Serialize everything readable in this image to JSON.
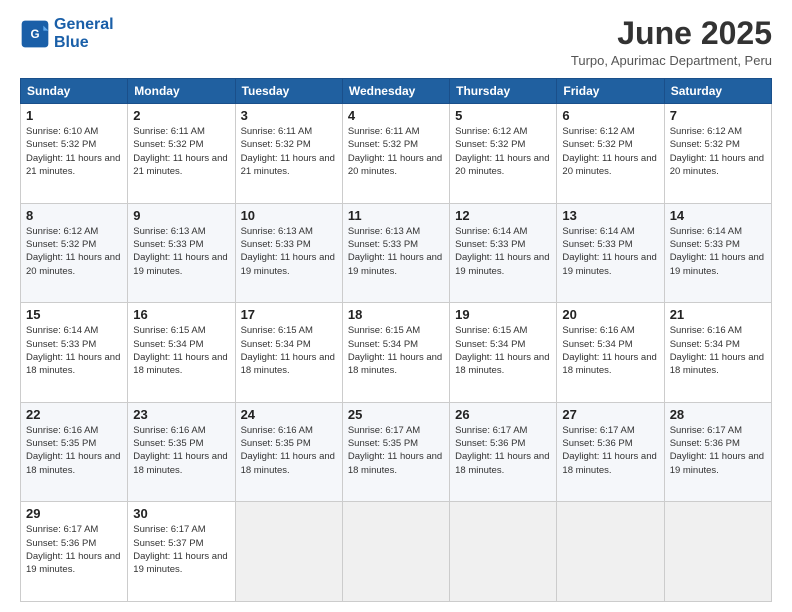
{
  "logo": {
    "line1": "General",
    "line2": "Blue"
  },
  "title": "June 2025",
  "location": "Turpo, Apurimac Department, Peru",
  "weekdays": [
    "Sunday",
    "Monday",
    "Tuesday",
    "Wednesday",
    "Thursday",
    "Friday",
    "Saturday"
  ],
  "weeks": [
    [
      {
        "day": "1",
        "sunrise": "Sunrise: 6:10 AM",
        "sunset": "Sunset: 5:32 PM",
        "daylight": "Daylight: 11 hours and 21 minutes."
      },
      {
        "day": "2",
        "sunrise": "Sunrise: 6:11 AM",
        "sunset": "Sunset: 5:32 PM",
        "daylight": "Daylight: 11 hours and 21 minutes."
      },
      {
        "day": "3",
        "sunrise": "Sunrise: 6:11 AM",
        "sunset": "Sunset: 5:32 PM",
        "daylight": "Daylight: 11 hours and 21 minutes."
      },
      {
        "day": "4",
        "sunrise": "Sunrise: 6:11 AM",
        "sunset": "Sunset: 5:32 PM",
        "daylight": "Daylight: 11 hours and 20 minutes."
      },
      {
        "day": "5",
        "sunrise": "Sunrise: 6:12 AM",
        "sunset": "Sunset: 5:32 PM",
        "daylight": "Daylight: 11 hours and 20 minutes."
      },
      {
        "day": "6",
        "sunrise": "Sunrise: 6:12 AM",
        "sunset": "Sunset: 5:32 PM",
        "daylight": "Daylight: 11 hours and 20 minutes."
      },
      {
        "day": "7",
        "sunrise": "Sunrise: 6:12 AM",
        "sunset": "Sunset: 5:32 PM",
        "daylight": "Daylight: 11 hours and 20 minutes."
      }
    ],
    [
      {
        "day": "8",
        "sunrise": "Sunrise: 6:12 AM",
        "sunset": "Sunset: 5:32 PM",
        "daylight": "Daylight: 11 hours and 20 minutes."
      },
      {
        "day": "9",
        "sunrise": "Sunrise: 6:13 AM",
        "sunset": "Sunset: 5:33 PM",
        "daylight": "Daylight: 11 hours and 19 minutes."
      },
      {
        "day": "10",
        "sunrise": "Sunrise: 6:13 AM",
        "sunset": "Sunset: 5:33 PM",
        "daylight": "Daylight: 11 hours and 19 minutes."
      },
      {
        "day": "11",
        "sunrise": "Sunrise: 6:13 AM",
        "sunset": "Sunset: 5:33 PM",
        "daylight": "Daylight: 11 hours and 19 minutes."
      },
      {
        "day": "12",
        "sunrise": "Sunrise: 6:14 AM",
        "sunset": "Sunset: 5:33 PM",
        "daylight": "Daylight: 11 hours and 19 minutes."
      },
      {
        "day": "13",
        "sunrise": "Sunrise: 6:14 AM",
        "sunset": "Sunset: 5:33 PM",
        "daylight": "Daylight: 11 hours and 19 minutes."
      },
      {
        "day": "14",
        "sunrise": "Sunrise: 6:14 AM",
        "sunset": "Sunset: 5:33 PM",
        "daylight": "Daylight: 11 hours and 19 minutes."
      }
    ],
    [
      {
        "day": "15",
        "sunrise": "Sunrise: 6:14 AM",
        "sunset": "Sunset: 5:33 PM",
        "daylight": "Daylight: 11 hours and 18 minutes."
      },
      {
        "day": "16",
        "sunrise": "Sunrise: 6:15 AM",
        "sunset": "Sunset: 5:34 PM",
        "daylight": "Daylight: 11 hours and 18 minutes."
      },
      {
        "day": "17",
        "sunrise": "Sunrise: 6:15 AM",
        "sunset": "Sunset: 5:34 PM",
        "daylight": "Daylight: 11 hours and 18 minutes."
      },
      {
        "day": "18",
        "sunrise": "Sunrise: 6:15 AM",
        "sunset": "Sunset: 5:34 PM",
        "daylight": "Daylight: 11 hours and 18 minutes."
      },
      {
        "day": "19",
        "sunrise": "Sunrise: 6:15 AM",
        "sunset": "Sunset: 5:34 PM",
        "daylight": "Daylight: 11 hours and 18 minutes."
      },
      {
        "day": "20",
        "sunrise": "Sunrise: 6:16 AM",
        "sunset": "Sunset: 5:34 PM",
        "daylight": "Daylight: 11 hours and 18 minutes."
      },
      {
        "day": "21",
        "sunrise": "Sunrise: 6:16 AM",
        "sunset": "Sunset: 5:34 PM",
        "daylight": "Daylight: 11 hours and 18 minutes."
      }
    ],
    [
      {
        "day": "22",
        "sunrise": "Sunrise: 6:16 AM",
        "sunset": "Sunset: 5:35 PM",
        "daylight": "Daylight: 11 hours and 18 minutes."
      },
      {
        "day": "23",
        "sunrise": "Sunrise: 6:16 AM",
        "sunset": "Sunset: 5:35 PM",
        "daylight": "Daylight: 11 hours and 18 minutes."
      },
      {
        "day": "24",
        "sunrise": "Sunrise: 6:16 AM",
        "sunset": "Sunset: 5:35 PM",
        "daylight": "Daylight: 11 hours and 18 minutes."
      },
      {
        "day": "25",
        "sunrise": "Sunrise: 6:17 AM",
        "sunset": "Sunset: 5:35 PM",
        "daylight": "Daylight: 11 hours and 18 minutes."
      },
      {
        "day": "26",
        "sunrise": "Sunrise: 6:17 AM",
        "sunset": "Sunset: 5:36 PM",
        "daylight": "Daylight: 11 hours and 18 minutes."
      },
      {
        "day": "27",
        "sunrise": "Sunrise: 6:17 AM",
        "sunset": "Sunset: 5:36 PM",
        "daylight": "Daylight: 11 hours and 18 minutes."
      },
      {
        "day": "28",
        "sunrise": "Sunrise: 6:17 AM",
        "sunset": "Sunset: 5:36 PM",
        "daylight": "Daylight: 11 hours and 19 minutes."
      }
    ],
    [
      {
        "day": "29",
        "sunrise": "Sunrise: 6:17 AM",
        "sunset": "Sunset: 5:36 PM",
        "daylight": "Daylight: 11 hours and 19 minutes."
      },
      {
        "day": "30",
        "sunrise": "Sunrise: 6:17 AM",
        "sunset": "Sunset: 5:37 PM",
        "daylight": "Daylight: 11 hours and 19 minutes."
      },
      null,
      null,
      null,
      null,
      null
    ]
  ]
}
